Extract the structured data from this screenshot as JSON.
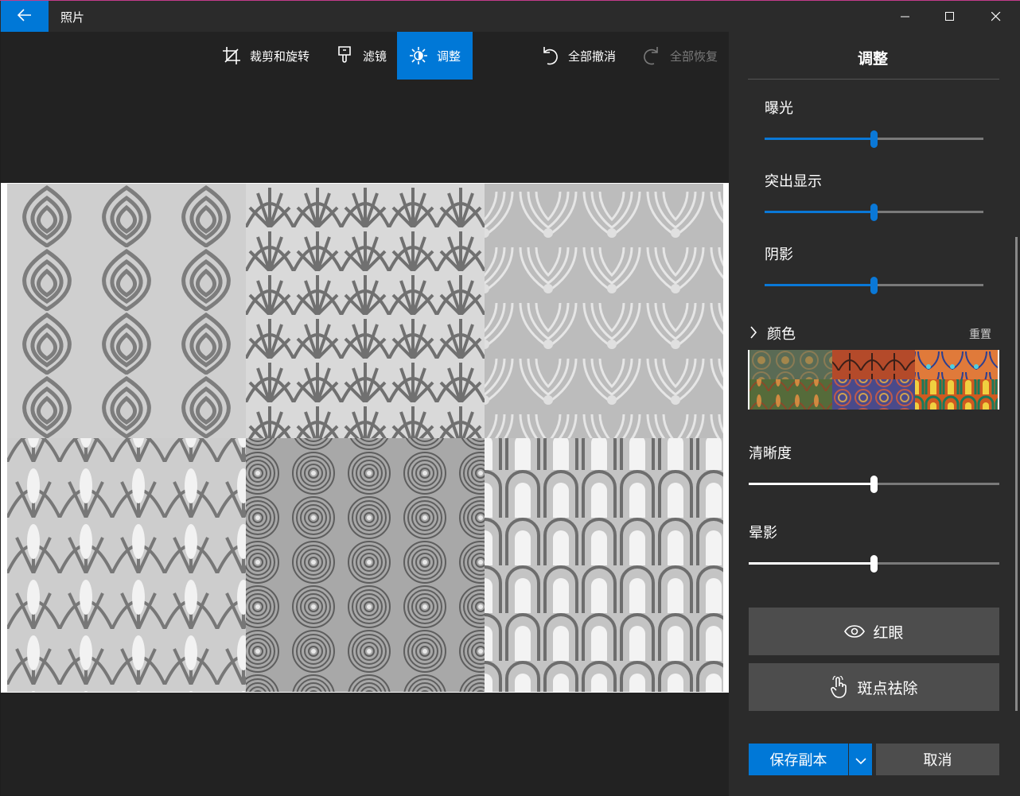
{
  "window": {
    "title": "照片"
  },
  "toolbar": {
    "crop_label": "裁剪和旋转",
    "filter_label": "滤镜",
    "adjust_label": "调整",
    "undo_all_label": "全部撤消",
    "redo_all_label": "全部恢复"
  },
  "panel": {
    "title": "调整",
    "sliders_top": [
      {
        "label": "曝光",
        "value": 0.5
      },
      {
        "label": "突出显示",
        "value": 0.5
      },
      {
        "label": "阴影",
        "value": 0.5
      }
    ],
    "color": {
      "label": "颜色",
      "reset_label": "重置"
    },
    "sliders_bottom": [
      {
        "label": "清晰度",
        "value": 0.5
      },
      {
        "label": "晕影",
        "value": 0.5
      }
    ],
    "red_eye_label": "红眼",
    "spot_fix_label": "斑点祛除",
    "save_copy_label": "保存副本",
    "cancel_label": "取消"
  },
  "colors": {
    "accent": "#0078d7",
    "panel_bg": "#2b2b2b",
    "workspace_bg": "#222222"
  }
}
